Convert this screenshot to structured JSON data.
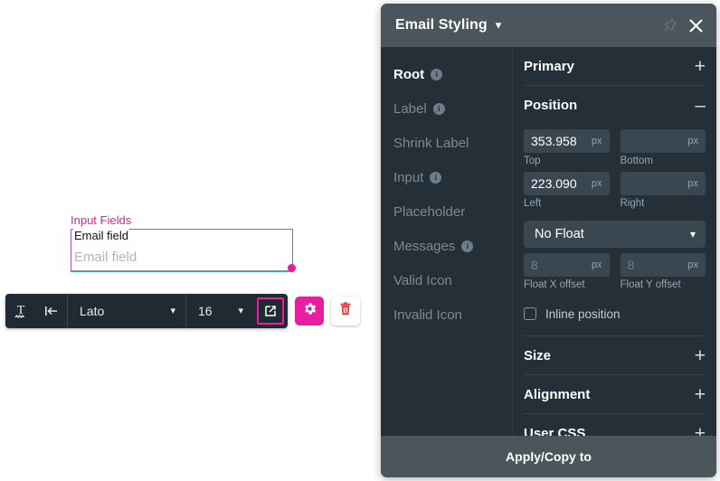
{
  "canvas": {
    "form": {
      "legend": "Input Fields",
      "label": "Email field",
      "placeholder": "Email field"
    }
  },
  "toolbar": {
    "text_format_icon": "text-format-icon",
    "indent_icon": "indent-left-icon",
    "font_family": "Lato",
    "font_size": "16",
    "external_link_icon": "external-link-icon",
    "gear_icon": "gear-icon",
    "trash_icon": "trash-icon"
  },
  "panel": {
    "header": {
      "title": "Email Styling",
      "chevron": "chevron-down-icon",
      "pin": "pin-icon",
      "close": "close-icon"
    },
    "sidebar": {
      "items": [
        {
          "label": "Root",
          "info": true,
          "active": true
        },
        {
          "label": "Label",
          "info": true,
          "active": false
        },
        {
          "label": "Shrink Label",
          "info": false,
          "active": false
        },
        {
          "label": "Input",
          "info": true,
          "active": false
        },
        {
          "label": "Placeholder",
          "info": false,
          "active": false
        },
        {
          "label": "Messages",
          "info": true,
          "active": false
        },
        {
          "label": "Valid Icon",
          "info": false,
          "active": false
        },
        {
          "label": "Invalid Icon",
          "info": false,
          "active": false
        }
      ]
    },
    "sections": {
      "primary": {
        "title": "Primary",
        "toggle": "+"
      },
      "position": {
        "title": "Position",
        "toggle": "–",
        "top": {
          "value": "353.958",
          "unit": "px",
          "label": "Top"
        },
        "bottom": {
          "value": "",
          "unit": "px",
          "label": "Bottom"
        },
        "left": {
          "value": "223.090",
          "unit": "px",
          "label": "Left"
        },
        "right": {
          "value": "",
          "unit": "px",
          "label": "Right"
        },
        "float_select": "No Float",
        "float_x": {
          "value": "8",
          "unit": "px",
          "label": "Float X offset"
        },
        "float_y": {
          "value": "8",
          "unit": "px",
          "label": "Float Y offset"
        },
        "inline_position_label": "Inline position"
      },
      "size": {
        "title": "Size",
        "toggle": "+"
      },
      "alignment": {
        "title": "Alignment",
        "toggle": "+"
      },
      "user_css": {
        "title": "User CSS",
        "toggle": "+"
      }
    },
    "footer": {
      "label": "Apply/Copy to"
    }
  },
  "colors": {
    "accent_pink": "#e81ea0",
    "panel_bg": "#242f38",
    "header_bg": "#4b565c",
    "input_bg": "#3b4750",
    "field_border": "#9b59d0",
    "field_underline": "#3b9fe0"
  }
}
